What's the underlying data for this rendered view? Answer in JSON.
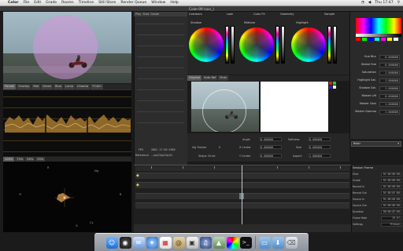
{
  "menubar": {
    "app_name": "Color",
    "items": [
      "File",
      "Edit",
      "Grade",
      "Rooms",
      "Timeline",
      "Still Store",
      "Render Queue",
      "Window",
      "Help"
    ],
    "clock": "Thu 17:47"
  },
  "window_title": "Color-09 (sun_)",
  "left_tabs": [
    "Parade",
    "Overlay",
    "Red",
    "Green",
    "Blue",
    "Luma",
    "Chroma",
    "Y'CbCr"
  ],
  "vector_tabs": [
    "100%",
    "75%",
    "50%",
    "25%"
  ],
  "vector_labels": {
    "r": "R",
    "mg": "Mg",
    "b": "B",
    "cy": "Cy",
    "g": "G",
    "yl": "Yl"
  },
  "center_header": [
    "Play",
    "Shot",
    "Grade"
  ],
  "center_fields": {
    "fps_label": "FPS",
    "timecode": "2001 17:55:1905",
    "reference_label": "Reference",
    "reference_value": "...pe/Clip/Clip/Cl"
  },
  "wheels": {
    "headers": [
      "Shadow",
      "Midtone",
      "Highlight"
    ],
    "top_tabs": [
      "Colorbars",
      "Look",
      "Color FX",
      "Geometry"
    ],
    "right_tab": "Sample"
  },
  "preview_tabs": [
    "Original",
    "Auto Ref",
    "Final"
  ],
  "right_params": [
    {
      "label": "Hue Blur",
      "value": "0.000000"
    },
    {
      "label": "Global Hue",
      "value": "0.000000"
    },
    {
      "label": "Saturation",
      "value": "1.000000"
    },
    {
      "label": "Highlight Sat.",
      "value": "1.000000"
    },
    {
      "label": "Shadow Sat.",
      "value": "1.000000"
    },
    {
      "label": "Master Lift",
      "value": "0.000000"
    },
    {
      "label": "Master Gain",
      "value": "1.000000"
    },
    {
      "label": "Master Gamma",
      "value": "1.000000"
    }
  ],
  "right_dropdown": "Basic",
  "info_rows": [
    {
      "label": "Angle",
      "value": "0.000000",
      "label2": "Softness",
      "value2": "0.000000"
    },
    {
      "label": "X Center",
      "value": "0.000000",
      "label2": "Size",
      "value2": "0.000000"
    },
    {
      "label": "Y Center",
      "value": "0.000000",
      "label2": "Aspect",
      "value2": "1.000000"
    }
  ],
  "info_extra": {
    "tracker_label": "Vig Tracker",
    "tracker_value": "0",
    "shape_label": "Shape",
    "shape_value": "Circle"
  },
  "rb_panel": {
    "title": "Session Frame",
    "rows": [
      {
        "label": "Shot",
        "value": "01:00:00:00"
      },
      {
        "label": "Grade",
        "value": "01:00:00:00"
      },
      {
        "label": "Record In",
        "value": "01:00:00:00"
      },
      {
        "label": "Record Out",
        "value": "01:00:02:00"
      },
      {
        "label": "Source In",
        "value": "01:00:00:00"
      },
      {
        "label": "Source Out",
        "value": "01:00:00:00"
      },
      {
        "label": "Duration",
        "value": "00:00:02:00"
      },
      {
        "label": "Frame Rate",
        "value": "29.97"
      },
      {
        "label": "Settings",
        "value": "Primary"
      }
    ]
  },
  "dock_icons": [
    "finder",
    "dashboard",
    "mail",
    "safari",
    "ical",
    "addressbook",
    "preview",
    "itunes",
    "iphoto",
    "color",
    "terminal",
    "folder",
    "downloads",
    "trash"
  ]
}
